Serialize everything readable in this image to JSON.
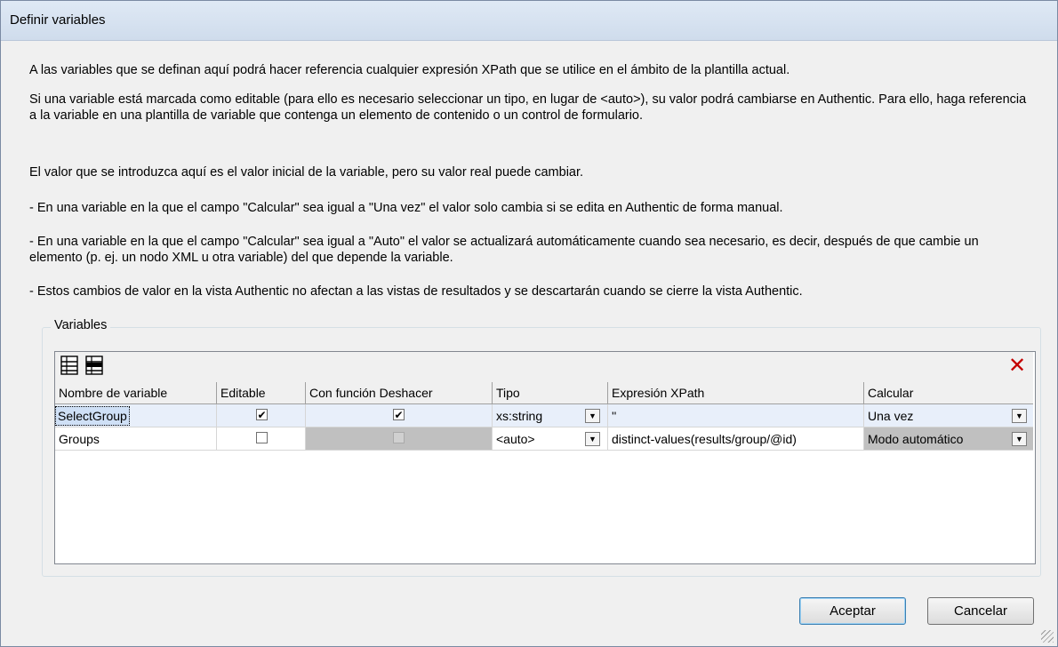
{
  "window": {
    "title": "Definir variables"
  },
  "description": [
    "A las variables que se definan aquí podrá hacer referencia cualquier expresión XPath que se utilice en el ámbito de la plantilla actual.",
    "Si una variable está marcada como editable (para ello es necesario seleccionar un tipo, en lugar de <auto>), su valor podrá cambiarse en Authentic. Para ello, haga referencia a la variable en una plantilla de variable que contenga un elemento de contenido o un control de formulario.",
    "El valor que se introduzca aquí es el valor inicial de la variable, pero su valor real puede cambiar.",
    "- En una variable en la que el campo \"Calcular\" sea igual a \"Una vez\" el valor solo cambia si se edita en Authentic de forma manual.",
    "- En una variable en la que el campo \"Calcular\" sea igual a \"Auto\" el valor se actualizará automáticamente cuando sea necesario, es decir, después de que cambie un elemento (p. ej. un nodo XML u otra variable) del que depende la variable.",
    "- Estos cambios de valor en la vista Authentic no afectan a las vistas de resultados y se descartarán cuando se cierre la vista Authentic."
  ],
  "variables_group": {
    "label": "Variables",
    "toolbar": {
      "append_icon": "append-row-icon",
      "insert_icon": "insert-row-icon",
      "delete_icon": "delete-icon",
      "delete_glyph": "✕"
    },
    "columns": [
      "Nombre de variable",
      "Editable",
      "Con función Deshacer",
      "Tipo",
      "Expresión XPath",
      "Calcular"
    ],
    "rows": [
      {
        "name": "SelectGroup",
        "editable": true,
        "undo": true,
        "undo_enabled": true,
        "type": "xs:string",
        "xpath": "''",
        "calc": "Una vez"
      },
      {
        "name": "Groups",
        "editable": false,
        "undo": false,
        "undo_enabled": false,
        "type": "<auto>",
        "xpath": "distinct-values(results/group/@id)",
        "calc": "Modo automático"
      }
    ]
  },
  "buttons": {
    "ok": "Aceptar",
    "cancel": "Cancelar"
  },
  "colors": {
    "selected_row": "#e8effa",
    "disabled_cell": "#c0c0c0",
    "delete_red": "#c40000"
  }
}
